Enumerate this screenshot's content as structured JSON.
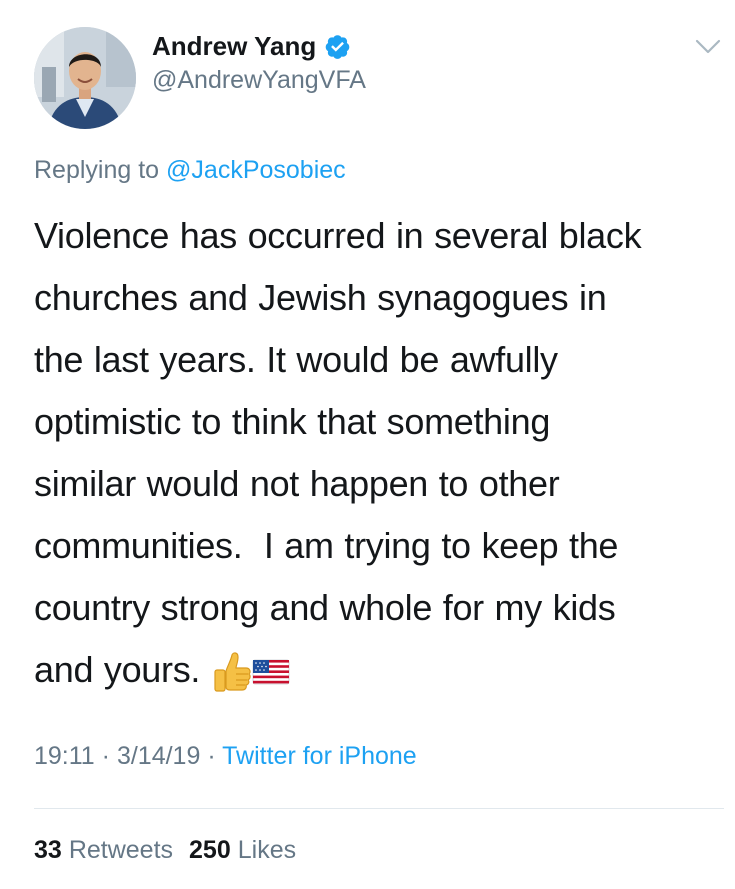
{
  "author": {
    "display_name": "Andrew Yang",
    "handle": "@AndrewYangVFA",
    "verified": true
  },
  "reply": {
    "prefix": "Replying to",
    "mention": "@JackPosobiec"
  },
  "tweet": {
    "lines": [
      "Violence has occurred in several black",
      "churches and Jewish synagogues in",
      "the last years. It would be awfully",
      "optimistic to think that something",
      "similar would not happen to other",
      "communities.  I am trying to keep the",
      "country strong and whole for my kids",
      "and yours."
    ],
    "emojis": [
      "thumbs-up-icon",
      "us-flag-icon"
    ]
  },
  "meta": {
    "time": "19:11",
    "separator": "·",
    "date": "3/14/19",
    "source": "Twitter for iPhone"
  },
  "stats": {
    "retweets_count": "33",
    "retweets_label": "Retweets",
    "likes_count": "250",
    "likes_label": "Likes"
  },
  "colors": {
    "accent": "#1da1f2",
    "secondary_text": "#657786",
    "primary_text": "#14171a",
    "divider": "#e1e8ed"
  }
}
